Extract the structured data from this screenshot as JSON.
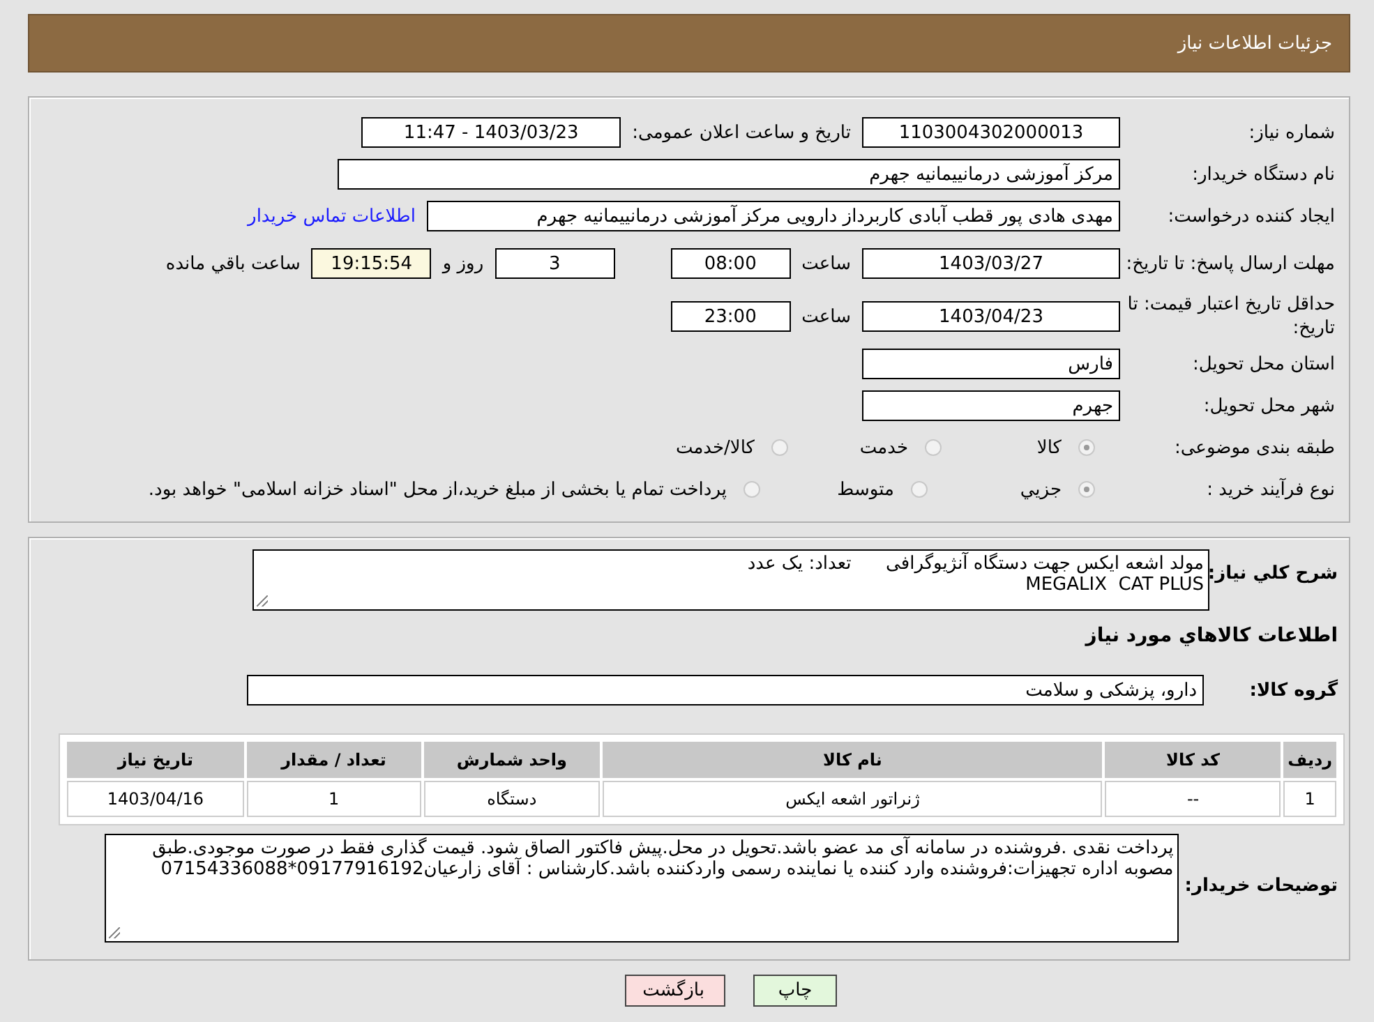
{
  "header": {
    "title": "جزئیات اطلاعات نیاز"
  },
  "form": {
    "need_number": {
      "label": "شماره نیاز:",
      "value": "1103004302000013"
    },
    "announce": {
      "label": "تاریخ و ساعت اعلان عمومی:",
      "value": "1403/03/23 - 11:47"
    },
    "buyer_org": {
      "label": "نام دستگاه خریدار:",
      "value": "مرکز آموزشی درمانییمانیه جهرم"
    },
    "requester": {
      "label": "ایجاد کننده درخواست:",
      "value": "مهدی هادی پور قطب آبادی کاربرداز دارویی مرکز آموزشی درمانییمانیه جهرم",
      "link": "اطلاعات تماس خریدار"
    },
    "deadline": {
      "label": "مهلت ارسال پاسخ: تا تاریخ:",
      "date": "1403/03/27",
      "time_label": "ساعت",
      "time": "08:00",
      "days": "3",
      "days_label": "روز و",
      "remaining": "19:15:54",
      "remaining_label": "ساعت باقي مانده"
    },
    "validity": {
      "label": "حداقل تاریخ اعتبار قیمت: تا تاریخ:",
      "date": "1403/04/23",
      "time_label": "ساعت",
      "time": "23:00"
    },
    "province": {
      "label": "استان محل تحویل:",
      "value": "فارس"
    },
    "city": {
      "label": "شهر محل تحویل:",
      "value": "جهرم"
    },
    "category": {
      "label": "طبقه بندی موضوعی:",
      "options": [
        {
          "label": "کالا",
          "selected": true
        },
        {
          "label": "خدمت",
          "selected": false
        },
        {
          "label": "کالا/خدمت",
          "selected": false
        }
      ]
    },
    "process": {
      "label": "نوع فرآیند خرید :",
      "options": [
        {
          "label": "جزيي",
          "selected": true
        },
        {
          "label": "متوسط",
          "selected": false
        },
        {
          "label": "پرداخت تمام یا بخشی از مبلغ خرید،از محل \"اسناد خزانه اسلامی\" خواهد بود.",
          "selected": false
        }
      ]
    }
  },
  "details": {
    "description": {
      "label": "شرح كلي نياز:",
      "lines": [
        "مولد اشعه ایکس جهت دستگاه آنژیوگرافی      تعداد: یک عدد",
        "MEGALIX  CAT PLUS"
      ]
    },
    "section_title": "اطلاعات كالاهاي مورد نياز",
    "group": {
      "label": "گروه كالا:",
      "value": "دارو، پزشکی و سلامت"
    },
    "table": {
      "columns": [
        "رديف",
        "کد کالا",
        "نام کالا",
        "واحد شمارش",
        "تعداد / مقدار",
        "تاریخ نیاز"
      ],
      "rows": [
        [
          "1",
          "--",
          "ژنراتور اشعه ایکس",
          "دستگاه",
          "1",
          "1403/04/16"
        ]
      ]
    },
    "notes": {
      "label": "توضیحات خریدار:",
      "value": "پرداخت نقدی .فروشنده در سامانه آی مد عضو باشد.تحویل در محل.پیش فاکتور الصاق شود. قیمت گذاری فقط در صورت موجودی.طبق مصوبه اداره تجهیزات:فروشنده وارد کننده یا نماینده رسمی واردکننده باشد.کارشناس : آقای زارعیان09177916192*07154336088"
    }
  },
  "buttons": [
    {
      "label": "چاپ",
      "kind": "print"
    },
    {
      "label": "بازگشت",
      "kind": "back"
    }
  ]
}
